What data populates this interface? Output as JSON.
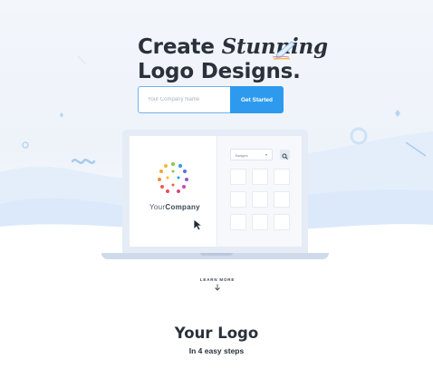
{
  "hero": {
    "headline_line1_prefix": "Create",
    "headline_script_word": "Stunning",
    "headline_line2": "Logo Designs."
  },
  "signup": {
    "company_placeholder": "Your Company Name",
    "company_value": "",
    "cta_label": "Get Started"
  },
  "preview": {
    "logo_text_light": "Your",
    "logo_text_bold": "Company",
    "badges_select": "Badges",
    "search_icon": "search-icon"
  },
  "learn_more": {
    "label": "LEARN MORE",
    "icon": "arrow-down-icon"
  },
  "steps_section": {
    "title": "Your Logo",
    "subtitle": "In 4 easy steps"
  },
  "colors": {
    "accent": "#2d9aed",
    "text": "#2a313b",
    "wave": "#d8e8fa"
  }
}
